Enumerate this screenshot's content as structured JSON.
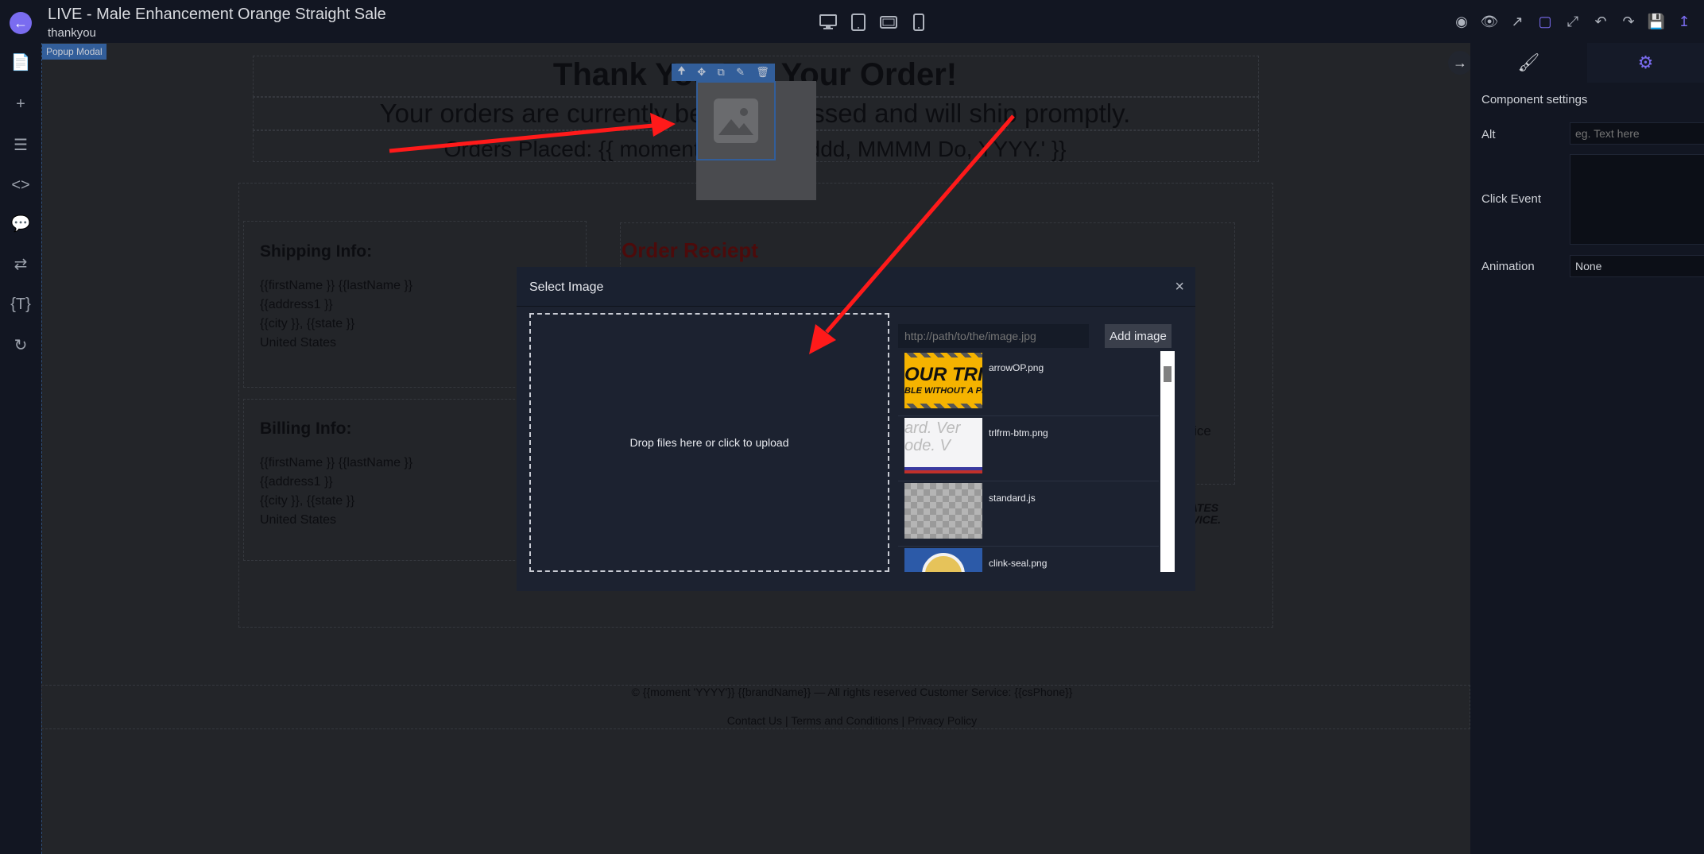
{
  "header": {
    "title": "LIVE - Male Enhancement Orange Straight Sale",
    "subtitle": "thankyou"
  },
  "canvas": {
    "tag": "Popup Modal",
    "thank_you_title": "Thank You For Your Order!",
    "processing_text": "Your orders are currently being processed and will ship promptly.",
    "orders_placed": "Orders Placed: {{ moment().format('dddd, MMMM Do, YYYY.' }}",
    "shipping": {
      "title": "Shipping Info:",
      "lines": [
        "{{firstName }} {{lastName }}",
        "{{address1 }}",
        "{{city }}, {{state }}",
        "United States"
      ]
    },
    "billing": {
      "title": "Billing Info:",
      "lines": [
        "{{firstName }} {{lastName }}",
        "{{address1 }}",
        "{{city }}, {{state }}",
        "United States"
      ]
    },
    "receipt_title": "Order Reciept",
    "price_fragment": "price",
    "states_fragment": [
      "STATES",
      "ERVICE."
    ],
    "footer_copyright": "© {{moment 'YYYY'}} {{brandName}} — All rights reserved Customer Service: {{csPhone}}",
    "footer_links": [
      "Contact Us",
      "Terms and Conditions",
      "Privacy Policy"
    ],
    "footer_sep": "|"
  },
  "right_panel": {
    "heading": "Component settings",
    "alt_label": "Alt",
    "alt_placeholder": "eg. Text here",
    "click_event_label": "Click Event",
    "animation_label": "Animation",
    "animation_value": "None"
  },
  "modal": {
    "title": "Select Image",
    "close": "×",
    "dropzone_text": "Drop files here or click to upload",
    "url_placeholder": "http://path/to/the/image.jpg",
    "add_button": "Add image",
    "assets": [
      {
        "name": "arrowOP.png",
        "thumb_text": "OUR TRIA",
        "thumb_sub": "BLE WITHOUT A PR"
      },
      {
        "name": "trlfrm-btm.png",
        "thumb_text": "ard.  Ver",
        "thumb_sub": "ode.    V"
      },
      {
        "name": "standard.js"
      },
      {
        "name": "clink-seal.png"
      }
    ]
  },
  "colors": {
    "accent": "#7a6cf0",
    "selection_blue": "#3b6fb6",
    "arrow_red": "#ff1a1a"
  }
}
